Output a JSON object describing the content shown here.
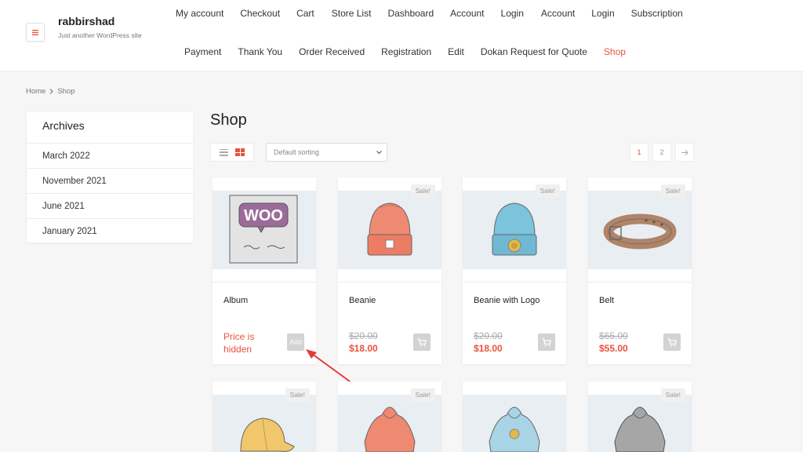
{
  "site": {
    "title": "rabbirshad",
    "tagline": "Just another WordPress site",
    "menu_icon": "hamburger-icon"
  },
  "nav": {
    "row1": [
      "My account",
      "Checkout",
      "Cart",
      "Store List",
      "Dashboard",
      "Account",
      "Login",
      "Account",
      "Login",
      "Subscription"
    ],
    "row2": [
      "Payment",
      "Thank You",
      "Order Received",
      "Registration",
      "Edit",
      "Dokan Request for Quote",
      "Shop"
    ],
    "active": "Shop"
  },
  "breadcrumb": {
    "home": "Home",
    "current": "Shop"
  },
  "archives": {
    "title": "Archives",
    "items": [
      "March 2022",
      "November 2021",
      "June 2021",
      "January 2021"
    ]
  },
  "shop": {
    "title": "Shop",
    "sort_value": "Default sorting",
    "pages": [
      "1",
      "2"
    ],
    "current_page": "1",
    "next_icon": "arrow-right-icon"
  },
  "products": [
    {
      "name": "Album",
      "price_hidden": "Price is hidden",
      "button": "Add",
      "sale": ""
    },
    {
      "name": "Beanie",
      "old_price": "$20.00",
      "price": "$18.00",
      "sale": "Sale!"
    },
    {
      "name": "Beanie with Logo",
      "old_price": "$20.00",
      "price": "$18.00",
      "sale": "Sale!"
    },
    {
      "name": "Belt",
      "old_price": "$65.00",
      "price": "$55.00",
      "sale": "Sale!"
    },
    {
      "name": "",
      "sale": "Sale!"
    },
    {
      "name": "",
      "sale": "Sale!"
    },
    {
      "name": "",
      "sale": ""
    },
    {
      "name": "",
      "sale": "Sale!"
    }
  ],
  "colors": {
    "accent": "#e8533e",
    "badge_bg": "#f0f0f0",
    "image_bg": "#e9eef2"
  }
}
